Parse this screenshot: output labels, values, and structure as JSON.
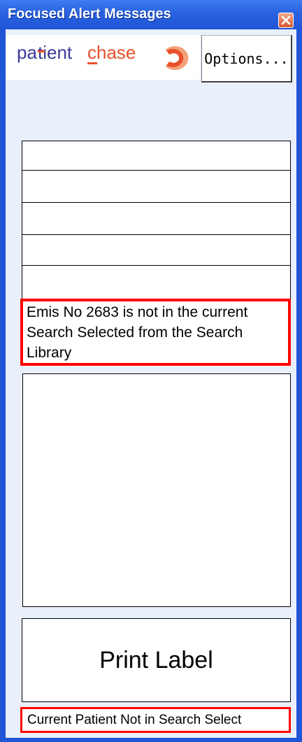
{
  "window": {
    "title": "Focused Alert Messages"
  },
  "logo": {
    "text_pa": "pa",
    "text_tient": "tient",
    "text_chase": "chase",
    "brand_color": "#e8512b",
    "text_color": "#3a3a9a"
  },
  "toolbar": {
    "options_label": "Options..."
  },
  "alert": {
    "message": "Emis No 2683 is not in the current Search Selected from the Search Library",
    "border_color": "#ff0000"
  },
  "print": {
    "label": "Print Label"
  },
  "status": {
    "text": "Current Patient Not in Search Select"
  },
  "icons": {
    "close": "close-icon",
    "logo": "patientchase-logo-icon"
  }
}
